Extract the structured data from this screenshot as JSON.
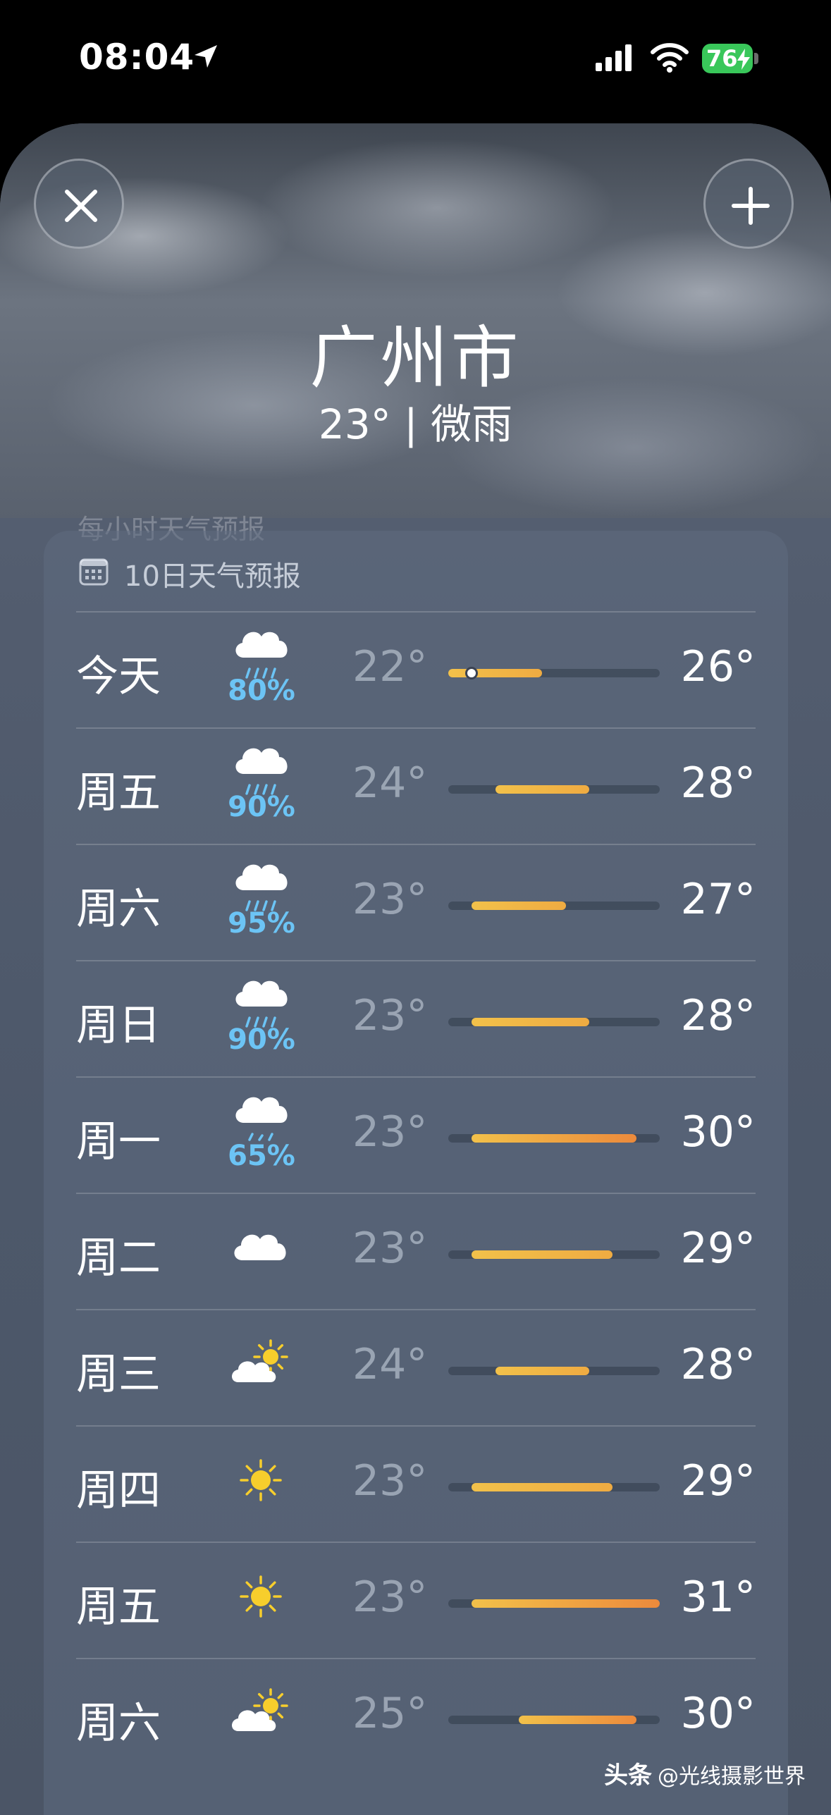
{
  "status_bar": {
    "time": "08:04",
    "battery": "76"
  },
  "header": {
    "city": "广州市",
    "summary": "23° | 微雨",
    "hourly_hint": "每小时天气预报"
  },
  "forecast": {
    "title": "10日天气预报",
    "scale": {
      "min": 22,
      "max": 31
    },
    "current_temp": 23,
    "colors": {
      "precip": "#6cc4f5",
      "bar_cool": "#f2c14a",
      "bar_warm": "#ec8a3c"
    },
    "days": [
      {
        "day": "今天",
        "icon": "cloud-rain-icon",
        "precip": "80%",
        "low": "22°",
        "high": "26°",
        "low_value": 22,
        "high_value": 26
      },
      {
        "day": "周五",
        "icon": "cloud-rain-icon",
        "precip": "90%",
        "low": "24°",
        "high": "28°",
        "low_value": 24,
        "high_value": 28
      },
      {
        "day": "周六",
        "icon": "cloud-rain-icon",
        "precip": "95%",
        "low": "23°",
        "high": "27°",
        "low_value": 23,
        "high_value": 27
      },
      {
        "day": "周日",
        "icon": "cloud-rain-icon",
        "precip": "90%",
        "low": "23°",
        "high": "28°",
        "low_value": 23,
        "high_value": 28
      },
      {
        "day": "周一",
        "icon": "cloud-drizzle-icon",
        "precip": "65%",
        "low": "23°",
        "high": "30°",
        "low_value": 23,
        "high_value": 30
      },
      {
        "day": "周二",
        "icon": "cloud-icon",
        "precip": "",
        "low": "23°",
        "high": "29°",
        "low_value": 23,
        "high_value": 29
      },
      {
        "day": "周三",
        "icon": "partly-cloudy-icon",
        "precip": "",
        "low": "24°",
        "high": "28°",
        "low_value": 24,
        "high_value": 28
      },
      {
        "day": "周四",
        "icon": "sun-icon",
        "precip": "",
        "low": "23°",
        "high": "29°",
        "low_value": 23,
        "high_value": 29
      },
      {
        "day": "周五",
        "icon": "sun-icon",
        "precip": "",
        "low": "23°",
        "high": "31°",
        "low_value": 23,
        "high_value": 31
      },
      {
        "day": "周六",
        "icon": "partly-cloudy-icon",
        "precip": "",
        "low": "25°",
        "high": "30°",
        "low_value": 25,
        "high_value": 30
      }
    ]
  },
  "watermark": {
    "brand": "头条",
    "text": "@光线摄影世界"
  }
}
